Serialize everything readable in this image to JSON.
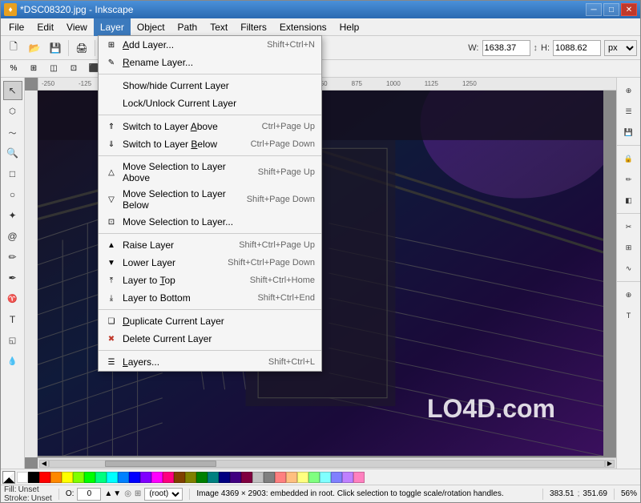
{
  "window": {
    "title": "*DSC08320.jpg - Inkscape",
    "icon": "♦"
  },
  "title_controls": {
    "minimize": "─",
    "maximize": "□",
    "close": "✕"
  },
  "menubar": {
    "items": [
      {
        "id": "file",
        "label": "File"
      },
      {
        "id": "edit",
        "label": "Edit"
      },
      {
        "id": "view",
        "label": "View"
      },
      {
        "id": "layer",
        "label": "Layer",
        "active": true
      },
      {
        "id": "object",
        "label": "Object"
      },
      {
        "id": "path",
        "label": "Path"
      },
      {
        "id": "text",
        "label": "Text"
      },
      {
        "id": "filters",
        "label": "Filters"
      },
      {
        "id": "extensions",
        "label": "Extensions"
      },
      {
        "id": "help",
        "label": "Help"
      }
    ]
  },
  "toolbar": {
    "width_label": "W:",
    "width_value": "1638.37",
    "height_label": "H:",
    "height_value": "1088.62",
    "unit": "px"
  },
  "layer_menu": {
    "items": [
      {
        "id": "add-layer",
        "icon": "⊞",
        "label": "Add Layer...",
        "shortcut": "Shift+Ctrl+N",
        "sep_after": false
      },
      {
        "id": "rename-layer",
        "icon": "✎",
        "label": "Rename Layer...",
        "shortcut": "",
        "sep_after": true
      },
      {
        "id": "show-hide",
        "icon": "",
        "label": "Show/hide Current Layer",
        "shortcut": "",
        "sep_after": false
      },
      {
        "id": "lock-unlock",
        "icon": "",
        "label": "Lock/Unlock Current Layer",
        "shortcut": "",
        "sep_after": true
      },
      {
        "id": "switch-above",
        "icon": "⇑",
        "label": "Switch to Layer Above",
        "shortcut": "Ctrl+Page Up",
        "sep_after": false
      },
      {
        "id": "switch-below",
        "icon": "⇓",
        "label": "Switch to Layer Below",
        "shortcut": "Ctrl+Page Down",
        "sep_after": true
      },
      {
        "id": "move-above",
        "icon": "△",
        "label": "Move Selection to Layer Above",
        "shortcut": "Shift+Page Up",
        "sep_after": false
      },
      {
        "id": "move-below",
        "icon": "▽",
        "label": "Move Selection to Layer Below",
        "shortcut": "Shift+Page Down",
        "sep_after": false
      },
      {
        "id": "move-to",
        "icon": "⊡",
        "label": "Move Selection to Layer...",
        "shortcut": "",
        "sep_after": true
      },
      {
        "id": "raise",
        "icon": "▲",
        "label": "Raise Layer",
        "shortcut": "Shift+Ctrl+Page Up",
        "sep_after": false
      },
      {
        "id": "lower",
        "icon": "▼",
        "label": "Lower Layer",
        "shortcut": "Shift+Ctrl+Page Down",
        "sep_after": false
      },
      {
        "id": "to-top",
        "icon": "⤒",
        "label": "Layer to Top",
        "shortcut": "Shift+Ctrl+Home",
        "sep_after": false
      },
      {
        "id": "to-bottom",
        "icon": "⤓",
        "label": "Layer to Bottom",
        "shortcut": "Shift+Ctrl+End",
        "sep_after": true
      },
      {
        "id": "duplicate",
        "icon": "❏",
        "label": "Duplicate Current Layer",
        "shortcut": "",
        "sep_after": false
      },
      {
        "id": "delete",
        "icon": "✖",
        "label": "Delete Current Layer",
        "shortcut": "",
        "sep_after": true
      },
      {
        "id": "layers-dialog",
        "icon": "☰",
        "label": "Layers...",
        "shortcut": "Shift+Ctrl+L",
        "sep_after": false
      }
    ]
  },
  "canvas_watermark": "LO4D.com",
  "status_bar": {
    "fill_label": "Fill:",
    "fill_value": "Unset",
    "stroke_label": "Stroke:",
    "stroke_value": "Unset",
    "opacity_label": "O:",
    "opacity_value": "0",
    "layer_select": "(root)",
    "status_text": "Image 4369 × 2903: embedded in root. Click selection to toggle scale/rotation handles.",
    "coords": "383.51",
    "coords2": "351.69",
    "zoom": "56%"
  },
  "left_tools": [
    "↖",
    "✂",
    "✏",
    "◎",
    "□",
    "◇",
    "⬟",
    "✦",
    "T",
    "✒",
    "🗙",
    "∿",
    "⬜"
  ],
  "right_tools": [
    "⊕",
    "⊡",
    "⊞",
    "✿",
    "☰",
    "∿",
    "⊲",
    "⊳",
    "⊹",
    "✂",
    "☻",
    "∿",
    "⊕"
  ],
  "colors": [
    "#ffffff",
    "#000000",
    "#ff0000",
    "#ff8000",
    "#ffff00",
    "#00ff00",
    "#00ffff",
    "#0000ff",
    "#8000ff",
    "#ff00ff",
    "#800000",
    "#804000",
    "#808000",
    "#008000",
    "#008080",
    "#000080",
    "#400080",
    "#800040",
    "#c0c0c0",
    "#808080",
    "#ff8080",
    "#ffbf80",
    "#ffff80",
    "#80ff80",
    "#80ffff",
    "#8080ff",
    "#bf80ff",
    "#ff80bf"
  ]
}
